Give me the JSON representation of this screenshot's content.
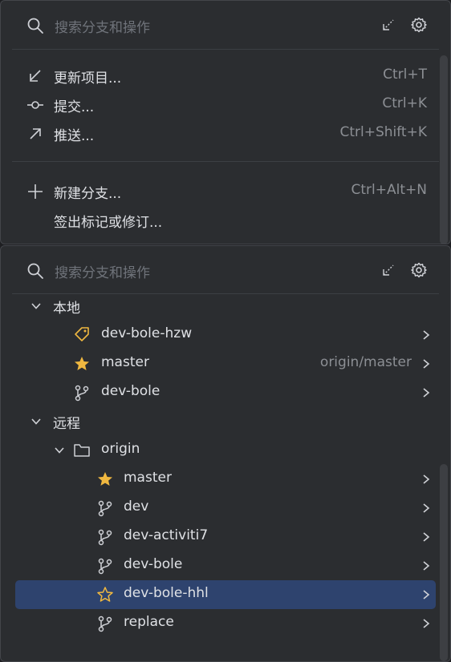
{
  "top_panel": {
    "search_placeholder": "搜索分支和操作",
    "actions": [
      {
        "label": "更新项目...",
        "shortcut": "Ctrl+T",
        "icon": "update-arrow-icon"
      },
      {
        "label": "提交...",
        "shortcut": "Ctrl+K",
        "icon": "commit-icon"
      },
      {
        "label": "推送...",
        "shortcut": "Ctrl+Shift+K",
        "icon": "push-arrow-icon"
      },
      {
        "label": "新建分支...",
        "shortcut": "Ctrl+Alt+N",
        "icon": "plus-icon"
      },
      {
        "label": "签出标记或修订...",
        "shortcut": "",
        "icon": ""
      }
    ]
  },
  "bottom_panel": {
    "search_placeholder": "搜索分支和操作",
    "tree": {
      "local_label": "本地",
      "local": [
        {
          "name": "dev-bole-hzw",
          "icon": "tag-icon",
          "tracking": ""
        },
        {
          "name": "master",
          "icon": "star-filled-icon",
          "tracking": "origin/master"
        },
        {
          "name": "dev-bole",
          "icon": "branch-icon",
          "tracking": ""
        }
      ],
      "remote_label": "远程",
      "origin_label": "origin",
      "remote": [
        {
          "name": "master",
          "icon": "star-filled-icon"
        },
        {
          "name": "dev",
          "icon": "branch-icon"
        },
        {
          "name": "dev-activiti7",
          "icon": "branch-icon"
        },
        {
          "name": "dev-bole",
          "icon": "branch-icon"
        },
        {
          "name": "dev-bole-hhl",
          "icon": "star-outline-icon",
          "selected": true
        },
        {
          "name": "replace",
          "icon": "branch-icon"
        }
      ]
    }
  },
  "colors": {
    "panel_bg": "#2b2d30",
    "selection": "#2e436e",
    "star": "#f0b840",
    "text": "#dfe1e5",
    "muted": "#8c8f94"
  }
}
